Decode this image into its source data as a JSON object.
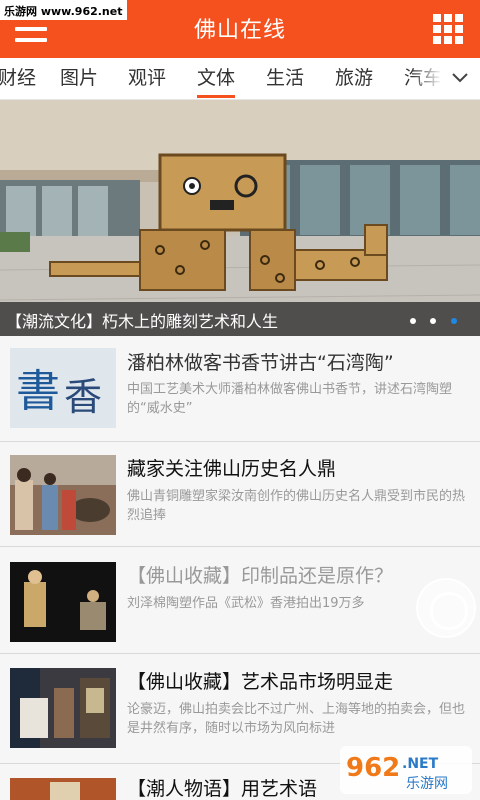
{
  "watermark": "乐游网 www.962.net",
  "header": {
    "title": "佛山在线",
    "menu_icon": "hamburger-menu-icon",
    "grid_icon": "grid-apps-icon",
    "color": "#f4511e"
  },
  "tabs": {
    "items": [
      "财经",
      "图片",
      "观评",
      "文体",
      "生活",
      "旅游",
      "汽车"
    ],
    "active_index": 3,
    "more_icon": "chevron-down-icon"
  },
  "banner": {
    "caption": "【潮流文化】朽木上的雕刻艺术和人生",
    "page_count": 3,
    "active_page": 3
  },
  "news": [
    {
      "title": "潘柏林做客书香节讲古“石湾陶”",
      "summary": "中国工艺美术大师潘柏林做客佛山书香节，讲述石湾陶塑的“威水史”"
    },
    {
      "title": "藏家关注佛山历史名人鼎",
      "summary": "佛山青铜雕塑家梁汝南创作的佛山历史名人鼎受到市民的热烈追捧"
    },
    {
      "title": "【佛山收藏】印制品还是原作？",
      "summary": "刘泽棉陶塑作品《武松》香港拍出19万多"
    },
    {
      "title": "【佛山收藏】艺术品市场明显走",
      "summary": "论豪迈，佛山拍卖会比不过广州、上海等地的拍卖会，但也是井然有序，随时以市场为风向标进"
    },
    {
      "title": "【潮人物语】用艺术语",
      "summary": ""
    }
  ],
  "logo_text": "962",
  "logo_sub": "乐游网",
  "logo_net": ".NET"
}
